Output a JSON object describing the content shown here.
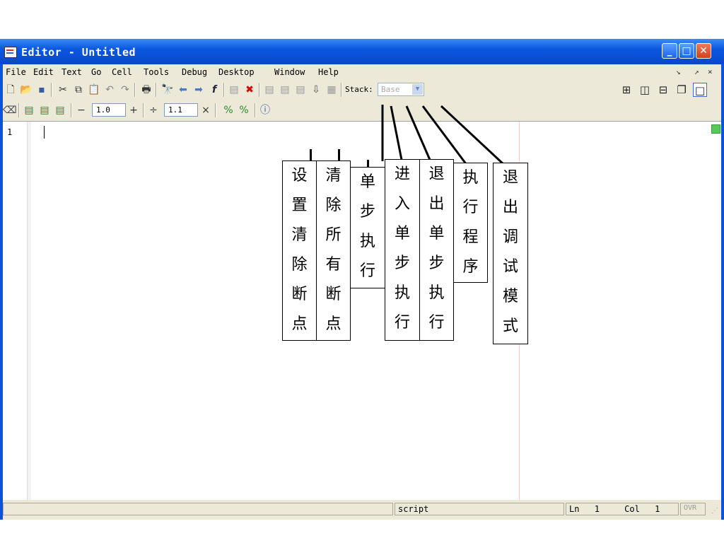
{
  "window": {
    "title": "Editor - Untitled",
    "minimize": "_",
    "maximize": "□",
    "close": "✕"
  },
  "menubar": {
    "items": [
      "File",
      "Edit",
      "Text",
      "Go",
      "Cell",
      "Tools",
      "Debug",
      "Desktop",
      "Window",
      "Help"
    ],
    "dock": "↘",
    "undock": "↗",
    "close": "×"
  },
  "toolbar1": {
    "icons": [
      "new-file-icon",
      "open-icon",
      "save-icon",
      "cut-icon",
      "copy-icon",
      "paste-icon",
      "undo-icon",
      "redo-icon",
      "print-icon",
      "find-icon",
      "back-icon",
      "forward-icon",
      "function-icon",
      "set-clear-breakpoint-icon",
      "clear-all-breakpoints-icon",
      "step-icon",
      "step-in-icon",
      "step-out-icon",
      "continue-icon",
      "exit-debug-icon"
    ],
    "stack_label": "Stack:",
    "stack_value": "Base"
  },
  "toolbar2": {
    "minus": "−",
    "value1": "1.0",
    "plus": "+",
    "divide": "÷",
    "value2": "1.1",
    "times": "×"
  },
  "editor": {
    "line_number": "1"
  },
  "statusbar": {
    "mode": "script",
    "ln_label": "Ln",
    "ln": "1",
    "col_label": "Col",
    "col": "1",
    "ovr": "OVR"
  },
  "annotations": [
    {
      "id": "set-clear-breakpoint",
      "text": [
        "设",
        "置",
        "清",
        "除",
        "断",
        "点"
      ]
    },
    {
      "id": "clear-all-breakpoints",
      "text": [
        "清",
        "除",
        "所",
        "有",
        "断",
        "点"
      ]
    },
    {
      "id": "step",
      "text": [
        "单",
        "步",
        "执",
        "行"
      ]
    },
    {
      "id": "step-in",
      "text": [
        "进",
        "入",
        "单",
        "步",
        "执",
        "行"
      ]
    },
    {
      "id": "step-out",
      "text": [
        "退",
        "出",
        "单",
        "步",
        "执",
        "行"
      ]
    },
    {
      "id": "run",
      "text": [
        "执",
        "行",
        "程",
        "序"
      ]
    },
    {
      "id": "exit-debug",
      "text": [
        "退",
        "出",
        "调",
        "试",
        "模",
        "式"
      ]
    }
  ]
}
